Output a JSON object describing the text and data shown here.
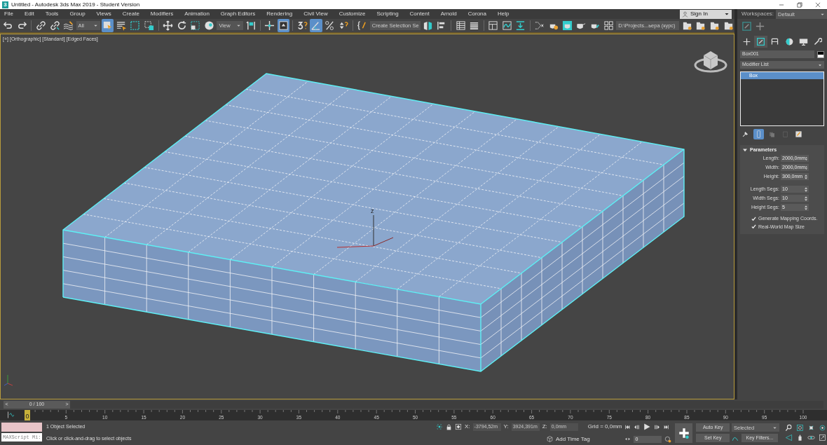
{
  "window": {
    "title": "Untitled - Autodesk 3ds Max 2019 - Student Version",
    "app_letter": "3"
  },
  "menu": [
    "File",
    "Edit",
    "Tools",
    "Group",
    "Views",
    "Create",
    "Modifiers",
    "Animation",
    "Graph Editors",
    "Rendering",
    "Civil View",
    "Customize",
    "Scripting",
    "Content",
    "Arnold",
    "Corona",
    "Help"
  ],
  "sign_in": "Sign In",
  "workspaces": {
    "label": "Workspaces:",
    "value": "Default"
  },
  "toolbar": [
    {
      "kind": "button",
      "selected": false
    },
    {
      "kind": "button",
      "selected": false
    },
    {
      "kind": "separator"
    },
    {
      "kind": "button",
      "selected": false
    },
    {
      "kind": "button",
      "selected": false
    },
    {
      "kind": "button",
      "selected": false
    },
    {
      "kind": "dropdown",
      "value": "All"
    },
    {
      "kind": "button",
      "selected": true
    },
    {
      "kind": "button",
      "selected": false
    },
    {
      "kind": "button",
      "selected": false
    },
    {
      "kind": "button",
      "selected": false
    },
    {
      "kind": "separator"
    },
    {
      "kind": "button",
      "selected": false
    },
    {
      "kind": "button",
      "selected": false
    },
    {
      "kind": "button",
      "selected": false
    },
    {
      "kind": "button",
      "selected": false
    },
    {
      "kind": "dropdown",
      "value": "View"
    },
    {
      "kind": "button",
      "selected": false
    },
    {
      "kind": "separator"
    },
    {
      "kind": "button",
      "selected": false
    },
    {
      "kind": "button",
      "selected": true
    },
    {
      "kind": "separator"
    },
    {
      "kind": "button",
      "selected": false
    },
    {
      "kind": "button",
      "selected": true
    },
    {
      "kind": "button",
      "selected": false
    },
    {
      "kind": "button",
      "selected": false
    },
    {
      "kind": "separator"
    },
    {
      "kind": "button",
      "selected": false
    },
    {
      "kind": "dropdown",
      "value": "Create Selection Se"
    },
    {
      "kind": "button",
      "selected": false
    },
    {
      "kind": "button",
      "selected": false
    },
    {
      "kind": "separator"
    },
    {
      "kind": "button",
      "selected": false
    },
    {
      "kind": "button",
      "selected": false
    },
    {
      "kind": "separator"
    },
    {
      "kind": "button",
      "selected": false
    },
    {
      "kind": "button",
      "selected": false
    },
    {
      "kind": "button",
      "selected": false
    },
    {
      "kind": "separator"
    },
    {
      "kind": "button",
      "selected": false
    },
    {
      "kind": "button",
      "selected": false
    },
    {
      "kind": "button",
      "selected": false
    },
    {
      "kind": "button",
      "selected": false
    },
    {
      "kind": "button",
      "selected": false
    },
    {
      "kind": "button",
      "selected": false
    },
    {
      "kind": "dropdown",
      "value": "D:\\Projects...ьера (курс)"
    },
    {
      "kind": "button",
      "selected": false
    },
    {
      "kind": "button",
      "selected": false
    },
    {
      "kind": "button",
      "selected": false
    },
    {
      "kind": "button",
      "selected": false
    }
  ],
  "viewport": {
    "labels": [
      "[+]",
      "[Orthographic]",
      "[Standard]",
      "[Edged Faces]"
    ],
    "gizmo_label": "z"
  },
  "command_panel": {
    "tabs": [
      {
        "selected": false
      },
      {
        "selected": true
      },
      {
        "selected": false
      },
      {
        "selected": false
      },
      {
        "selected": false
      },
      {
        "selected": false
      }
    ],
    "object_name": "Box001",
    "modifier_list": "Modifier List",
    "stack": [
      {
        "label": "Box",
        "selected": true
      }
    ],
    "stack_tools": [
      {
        "selected": false
      },
      {
        "selected": true
      },
      {
        "selected": false
      },
      {
        "selected": false
      },
      {
        "selected": false
      }
    ],
    "rollout": {
      "title": "Parameters",
      "expanded": true,
      "fields": [
        {
          "label": "Length:",
          "value": "2000,0mm"
        },
        {
          "label": "Width:",
          "value": "2000,0mm"
        },
        {
          "label": "Height:",
          "value": "300,0mm"
        }
      ],
      "segs": [
        {
          "label": "Length Segs:",
          "value": "10"
        },
        {
          "label": "Width Segs:",
          "value": "10"
        },
        {
          "label": "Height Segs:",
          "value": "5"
        }
      ],
      "options": [
        {
          "label": "Generate Mapping Coords.",
          "checked": true
        },
        {
          "label": "Real-World Map Size",
          "checked": true
        }
      ]
    }
  },
  "timeline": {
    "prev": "<",
    "next": ">",
    "thumb": "0 / 100",
    "level": 0,
    "marker": "0",
    "ticks": [
      "5",
      "10",
      "15",
      "20",
      "25",
      "30",
      "35",
      "40",
      "45",
      "50",
      "55",
      "60",
      "65",
      "70",
      "75",
      "80",
      "85",
      "90",
      "95",
      "100"
    ]
  },
  "status": {
    "listener": "MAXScript Mi:",
    "prompts": [
      "1 Object Selected",
      "Click or click-and-drag to select objects"
    ],
    "coords": [
      {
        "label": "X:",
        "value": "-3794,52m"
      },
      {
        "label": "Y:",
        "value": "3924,391m"
      },
      {
        "label": "Z:",
        "value": "0,0mm"
      }
    ],
    "grid": "Grid = 0,0mm",
    "time_tag": "Add Time Tag",
    "frame": "0",
    "auto_key": "Auto Key",
    "set_key": "Set Key",
    "key_mode": "Selected",
    "key_filters": "Key Filters..."
  }
}
